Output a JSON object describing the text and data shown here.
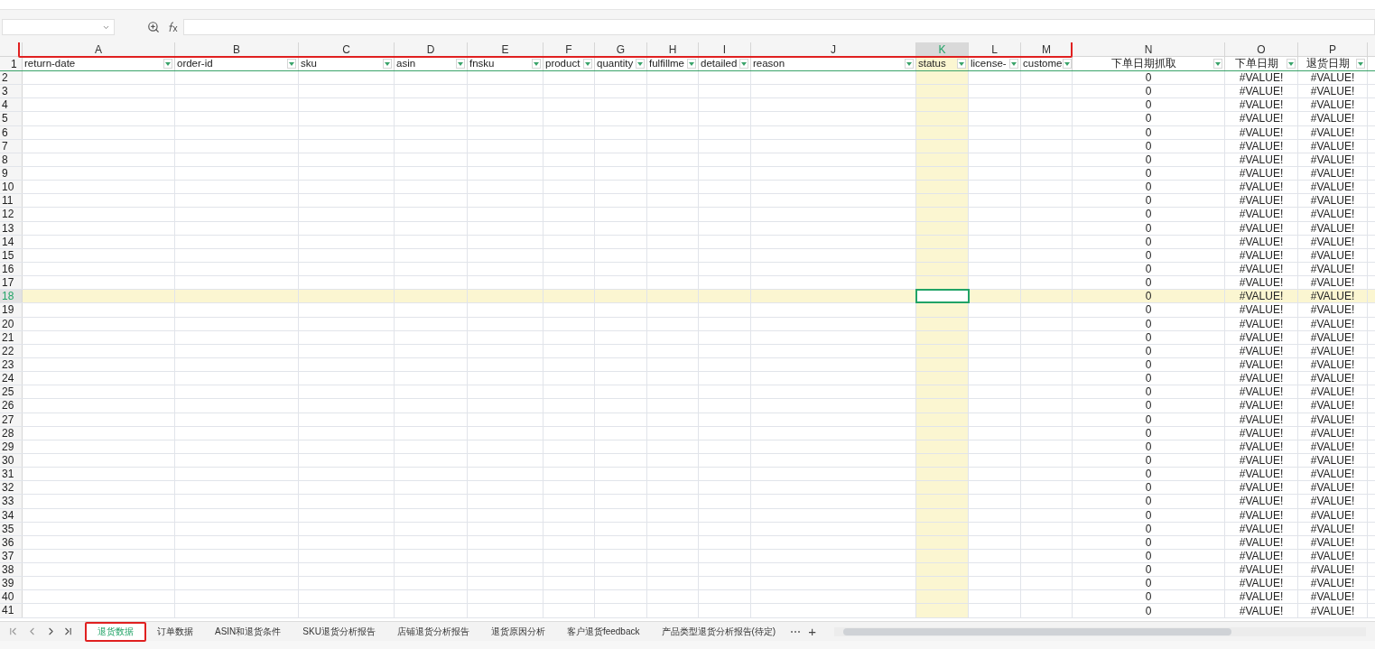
{
  "columns": [
    {
      "letter": "A",
      "header": "return-date",
      "selected": false
    },
    {
      "letter": "B",
      "header": "order-id",
      "selected": false
    },
    {
      "letter": "C",
      "header": "sku",
      "selected": false
    },
    {
      "letter": "D",
      "header": "asin",
      "selected": false
    },
    {
      "letter": "E",
      "header": "fnsku",
      "selected": false
    },
    {
      "letter": "F",
      "header": "product",
      "selected": false
    },
    {
      "letter": "G",
      "header": "quantity",
      "selected": false
    },
    {
      "letter": "H",
      "header": "fulfillme",
      "selected": false
    },
    {
      "letter": "I",
      "header": "detailed",
      "selected": false
    },
    {
      "letter": "J",
      "header": "reason",
      "selected": false
    },
    {
      "letter": "K",
      "header": "status",
      "selected": true
    },
    {
      "letter": "L",
      "header": "license-",
      "selected": false
    },
    {
      "letter": "M",
      "header": "custome",
      "selected": false
    },
    {
      "letter": "N",
      "header": "下单日期抓取",
      "selected": false
    },
    {
      "letter": "O",
      "header": "下单日期",
      "selected": false
    },
    {
      "letter": "P",
      "header": "退货日期",
      "selected": false
    }
  ],
  "header_row_number": "1",
  "rows": [
    {
      "number": "2",
      "values": [
        "0",
        "#VALUE!",
        "#VALUE!"
      ],
      "selected": false
    },
    {
      "number": "3",
      "values": [
        "0",
        "#VALUE!",
        "#VALUE!"
      ],
      "selected": false
    },
    {
      "number": "4",
      "values": [
        "0",
        "#VALUE!",
        "#VALUE!"
      ],
      "selected": false
    },
    {
      "number": "5",
      "values": [
        "0",
        "#VALUE!",
        "#VALUE!"
      ],
      "selected": false
    },
    {
      "number": "6",
      "values": [
        "0",
        "#VALUE!",
        "#VALUE!"
      ],
      "selected": false
    },
    {
      "number": "7",
      "values": [
        "0",
        "#VALUE!",
        "#VALUE!"
      ],
      "selected": false
    },
    {
      "number": "8",
      "values": [
        "0",
        "#VALUE!",
        "#VALUE!"
      ],
      "selected": false
    },
    {
      "number": "9",
      "values": [
        "0",
        "#VALUE!",
        "#VALUE!"
      ],
      "selected": false
    },
    {
      "number": "10",
      "values": [
        "0",
        "#VALUE!",
        "#VALUE!"
      ],
      "selected": false
    },
    {
      "number": "11",
      "values": [
        "0",
        "#VALUE!",
        "#VALUE!"
      ],
      "selected": false
    },
    {
      "number": "12",
      "values": [
        "0",
        "#VALUE!",
        "#VALUE!"
      ],
      "selected": false
    },
    {
      "number": "13",
      "values": [
        "0",
        "#VALUE!",
        "#VALUE!"
      ],
      "selected": false
    },
    {
      "number": "14",
      "values": [
        "0",
        "#VALUE!",
        "#VALUE!"
      ],
      "selected": false
    },
    {
      "number": "15",
      "values": [
        "0",
        "#VALUE!",
        "#VALUE!"
      ],
      "selected": false
    },
    {
      "number": "16",
      "values": [
        "0",
        "#VALUE!",
        "#VALUE!"
      ],
      "selected": false
    },
    {
      "number": "17",
      "values": [
        "0",
        "#VALUE!",
        "#VALUE!"
      ],
      "selected": false
    },
    {
      "number": "18",
      "values": [
        "0",
        "#VALUE!",
        "#VALUE!"
      ],
      "selected": true
    },
    {
      "number": "19",
      "values": [
        "0",
        "#VALUE!",
        "#VALUE!"
      ],
      "selected": false
    },
    {
      "number": "20",
      "values": [
        "0",
        "#VALUE!",
        "#VALUE!"
      ],
      "selected": false
    },
    {
      "number": "21",
      "values": [
        "0",
        "#VALUE!",
        "#VALUE!"
      ],
      "selected": false
    },
    {
      "number": "22",
      "values": [
        "0",
        "#VALUE!",
        "#VALUE!"
      ],
      "selected": false
    },
    {
      "number": "23",
      "values": [
        "0",
        "#VALUE!",
        "#VALUE!"
      ],
      "selected": false
    },
    {
      "number": "24",
      "values": [
        "0",
        "#VALUE!",
        "#VALUE!"
      ],
      "selected": false
    },
    {
      "number": "25",
      "values": [
        "0",
        "#VALUE!",
        "#VALUE!"
      ],
      "selected": false
    },
    {
      "number": "26",
      "values": [
        "0",
        "#VALUE!",
        "#VALUE!"
      ],
      "selected": false
    },
    {
      "number": "27",
      "values": [
        "0",
        "#VALUE!",
        "#VALUE!"
      ],
      "selected": false
    },
    {
      "number": "28",
      "values": [
        "0",
        "#VALUE!",
        "#VALUE!"
      ],
      "selected": false
    },
    {
      "number": "29",
      "values": [
        "0",
        "#VALUE!",
        "#VALUE!"
      ],
      "selected": false
    },
    {
      "number": "30",
      "values": [
        "0",
        "#VALUE!",
        "#VALUE!"
      ],
      "selected": false
    },
    {
      "number": "31",
      "values": [
        "0",
        "#VALUE!",
        "#VALUE!"
      ],
      "selected": false
    },
    {
      "number": "32",
      "values": [
        "0",
        "#VALUE!",
        "#VALUE!"
      ],
      "selected": false
    },
    {
      "number": "33",
      "values": [
        "0",
        "#VALUE!",
        "#VALUE!"
      ],
      "selected": false
    },
    {
      "number": "34",
      "values": [
        "0",
        "#VALUE!",
        "#VALUE!"
      ],
      "selected": false
    },
    {
      "number": "35",
      "values": [
        "0",
        "#VALUE!",
        "#VALUE!"
      ],
      "selected": false
    },
    {
      "number": "36",
      "values": [
        "0",
        "#VALUE!",
        "#VALUE!"
      ],
      "selected": false
    },
    {
      "number": "37",
      "values": [
        "0",
        "#VALUE!",
        "#VALUE!"
      ],
      "selected": false
    },
    {
      "number": "38",
      "values": [
        "0",
        "#VALUE!",
        "#VALUE!"
      ],
      "selected": false
    },
    {
      "number": "39",
      "values": [
        "0",
        "#VALUE!",
        "#VALUE!"
      ],
      "selected": false
    },
    {
      "number": "40",
      "values": [
        "0",
        "#VALUE!",
        "#VALUE!"
      ],
      "selected": false
    },
    {
      "number": "41",
      "values": [
        "0",
        "#VALUE!",
        "#VALUE!"
      ],
      "selected": false
    }
  ],
  "sheet_tabs": [
    {
      "label": "退货数据",
      "selected": true
    },
    {
      "label": "订单数据",
      "selected": false
    },
    {
      "label": "ASIN和退货条件",
      "selected": false
    },
    {
      "label": "SKU退货分析报告",
      "selected": false
    },
    {
      "label": "店铺退货分析报告",
      "selected": false
    },
    {
      "label": "退货原因分析",
      "selected": false
    },
    {
      "label": "客户退货feedback",
      "selected": false
    },
    {
      "label": "产品类型退货分析报告(待定)",
      "selected": false
    }
  ],
  "more_tabs": "⋯",
  "add_tab": "+"
}
